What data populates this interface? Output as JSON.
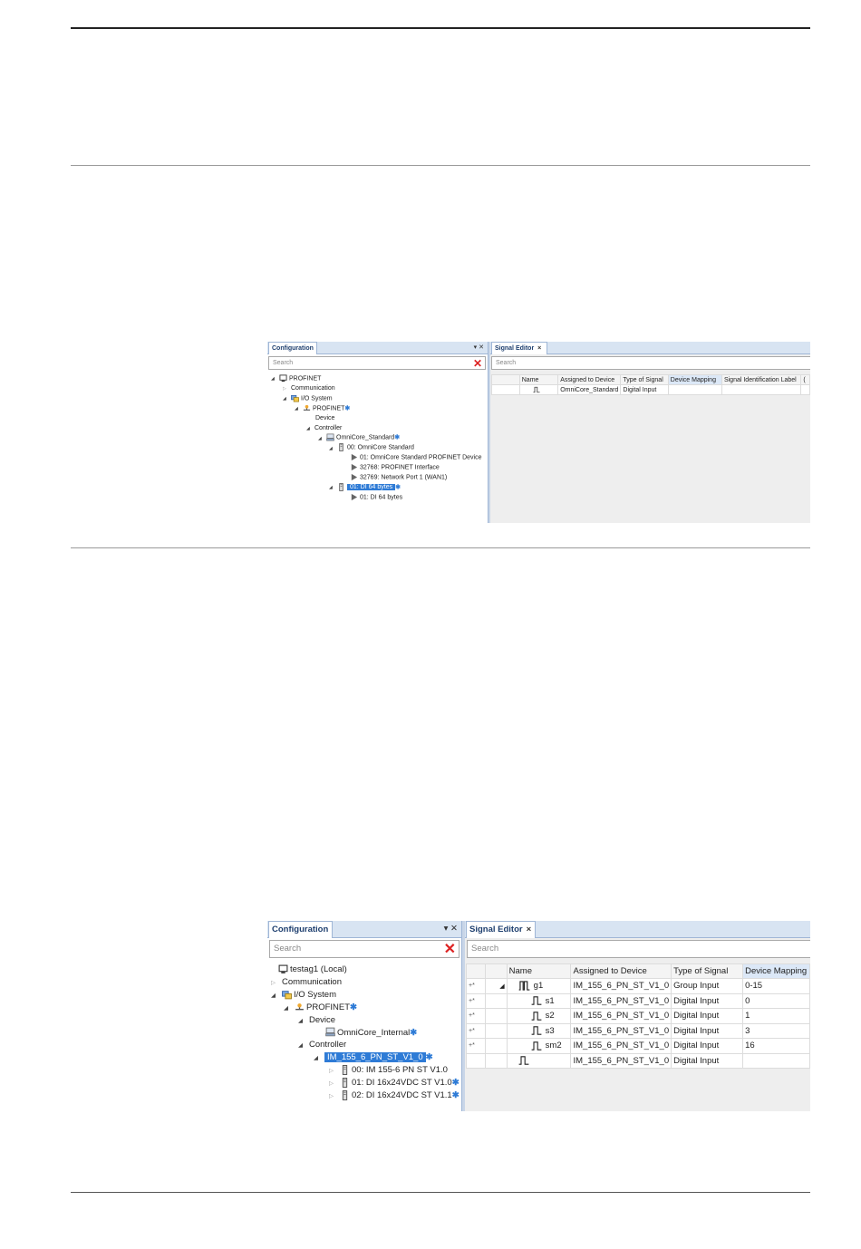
{
  "shot1": {
    "config_tab": "Configuration",
    "config_ctrls": "▾ ✕",
    "search_placeholder": "Search",
    "tree": [
      {
        "label": "PROFINET",
        "arrow": "open",
        "icon": "pc-icon"
      },
      {
        "label": "Communication",
        "arrow": "closed",
        "icon": ""
      },
      {
        "label": "I/O System",
        "arrow": "open",
        "icon": "io-system-icon"
      },
      {
        "label": "PROFINET",
        "arrow": "open",
        "icon": "network-icon",
        "star": "✱"
      },
      {
        "label": "Device",
        "arrow": "",
        "icon": ""
      },
      {
        "label": "Controller",
        "arrow": "open",
        "icon": ""
      },
      {
        "label": "OmniCore_Standard",
        "arrow": "open",
        "icon": "controller-icon",
        "star": "✱"
      },
      {
        "label": "00: OmniCore Standard",
        "arrow": "open",
        "icon": "module-icon"
      },
      {
        "label": "01: OmniCore Standard PROFINET Device",
        "arrow": "",
        "icon": "play-icon"
      },
      {
        "label": "32768: PROFINET Interface",
        "arrow": "",
        "icon": "play-icon"
      },
      {
        "label": "32769: Network Port 1 (WAN1)",
        "arrow": "",
        "icon": "play-icon"
      },
      {
        "label": "01: DI 64 bytes",
        "arrow": "open",
        "icon": "module-icon",
        "selected": true,
        "star": "✱"
      },
      {
        "label": "01: DI 64 bytes",
        "arrow": "",
        "icon": "play-icon"
      }
    ],
    "signal_tab": "Signal Editor",
    "columns": [
      "",
      "Name",
      "Assigned to Device",
      "Type of Signal",
      "Device Mapping",
      "Signal Identification Label",
      "("
    ],
    "rows": [
      {
        "name": "",
        "device": "OmniCore_Standard",
        "type": "Digital Input",
        "mapping": "",
        "label": ""
      }
    ]
  },
  "shot2": {
    "config_tab": "Configuration",
    "config_ctrls": "▾ ✕",
    "search_placeholder": "Search",
    "tree": [
      {
        "label": "testag1 (Local)",
        "arrow": "",
        "icon": "pc-icon"
      },
      {
        "label": "Communication",
        "arrow": "closed",
        "icon": ""
      },
      {
        "label": "I/O System",
        "arrow": "open",
        "icon": "io-system-icon"
      },
      {
        "label": "PROFINET",
        "arrow": "open",
        "icon": "network-icon",
        "star": "✱"
      },
      {
        "label": "Device",
        "arrow": "open",
        "icon": ""
      },
      {
        "label": "OmniCore_Internal",
        "arrow": "",
        "icon": "controller-icon",
        "star": "✱"
      },
      {
        "label": "Controller",
        "arrow": "open",
        "icon": ""
      },
      {
        "label": "IM_155_6_PN_ST_V1_0",
        "arrow": "open",
        "icon": "",
        "selected": true,
        "star": "✱"
      },
      {
        "label": "00: IM 155-6 PN ST V1.0",
        "arrow": "closed",
        "icon": "module-icon"
      },
      {
        "label": "01: DI 16x24VDC ST V1.0",
        "arrow": "closed",
        "icon": "module-icon",
        "star": "✱"
      },
      {
        "label": "02: DI 16x24VDC ST V1.1",
        "arrow": "closed",
        "icon": "module-icon",
        "star": "✱"
      }
    ],
    "signal_tab": "Signal Editor",
    "columns": [
      "",
      "",
      "Name",
      "Assigned to Device",
      "Type of Signal",
      "Device Mapping"
    ],
    "rows": [
      {
        "mark": "+*",
        "exp": "◢",
        "sig": "group",
        "name": "g1",
        "device": "IM_155_6_PN_ST_V1_0",
        "type": "Group Input",
        "mapping": "0-15"
      },
      {
        "mark": "+*",
        "exp": "",
        "sig": "child",
        "name": "s1",
        "device": "IM_155_6_PN_ST_V1_0",
        "type": "Digital Input",
        "mapping": "0"
      },
      {
        "mark": "+*",
        "exp": "",
        "sig": "child",
        "name": "s2",
        "device": "IM_155_6_PN_ST_V1_0",
        "type": "Digital Input",
        "mapping": "1"
      },
      {
        "mark": "+*",
        "exp": "",
        "sig": "child",
        "name": "s3",
        "device": "IM_155_6_PN_ST_V1_0",
        "type": "Digital Input",
        "mapping": "3"
      },
      {
        "mark": "+*",
        "exp": "",
        "sig": "child",
        "name": "sm2",
        "device": "IM_155_6_PN_ST_V1_0",
        "type": "Digital Input",
        "mapping": "16"
      },
      {
        "mark": "",
        "exp": "",
        "sig": "plain",
        "name": "",
        "device": "IM_155_6_PN_ST_V1_0",
        "type": "Digital Input",
        "mapping": ""
      }
    ]
  }
}
